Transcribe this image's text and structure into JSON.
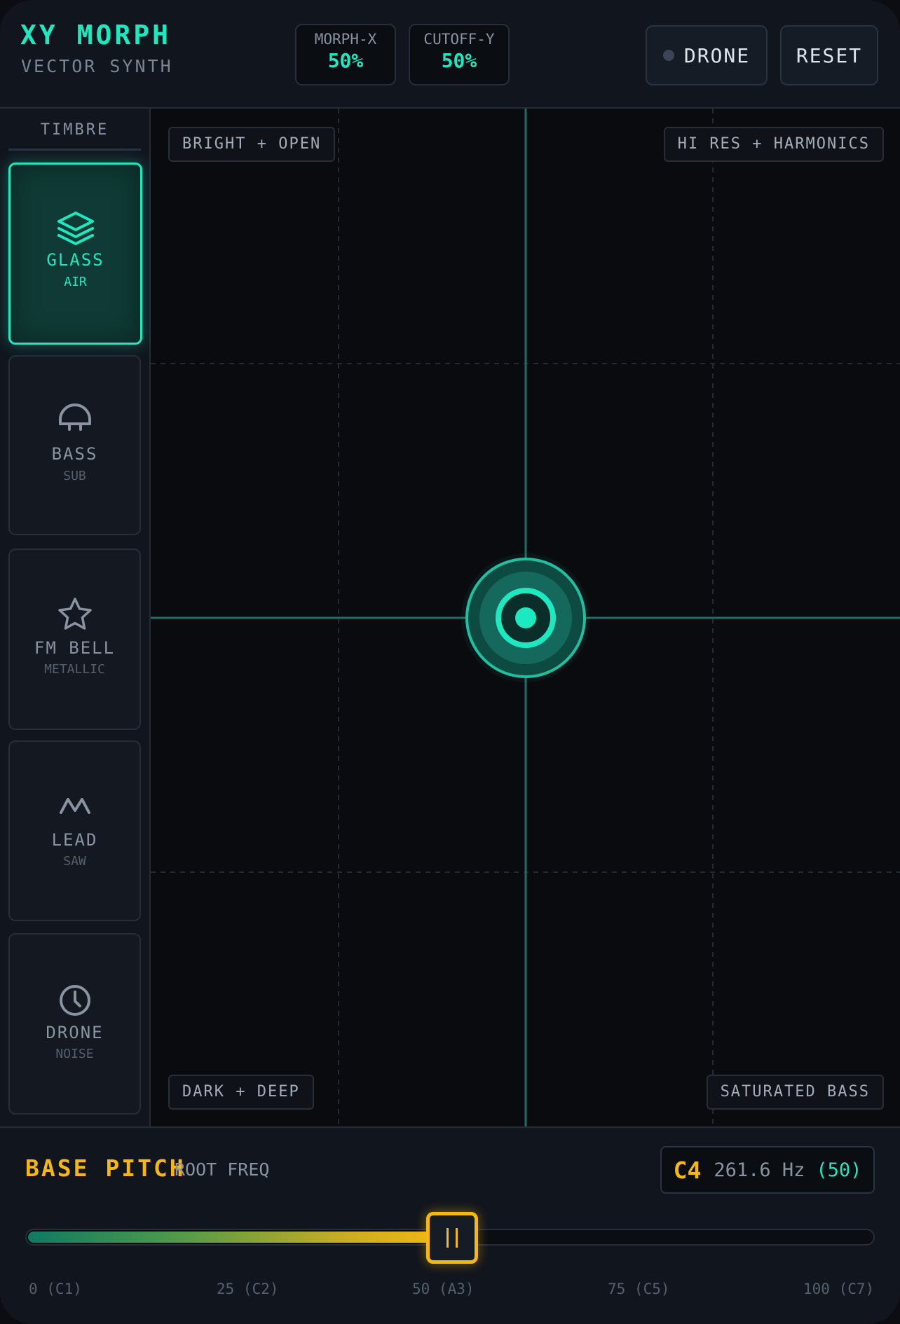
{
  "app": {
    "title": "XY MORPH",
    "subtitle": "VECTOR SYNTH"
  },
  "params": [
    {
      "label": "MORPH-X",
      "value": "50%"
    },
    {
      "label": "CUTOFF-Y",
      "value": "50%"
    }
  ],
  "header_buttons": {
    "drone": "DRONE",
    "reset": "RESET"
  },
  "sidebar": {
    "title": "TIMBRE",
    "items": [
      {
        "name": "GLASS",
        "sub": "AIR",
        "icon": "layers-icon",
        "active": true
      },
      {
        "name": "BASS",
        "sub": "SUB",
        "icon": "headphones-icon",
        "active": false
      },
      {
        "name": "FM BELL",
        "sub": "METALLIC",
        "icon": "star-icon",
        "active": false
      },
      {
        "name": "LEAD",
        "sub": "SAW",
        "icon": "saw-wave-icon",
        "active": false
      },
      {
        "name": "DRONE",
        "sub": "NOISE",
        "icon": "clock-icon",
        "active": false
      }
    ]
  },
  "pad": {
    "corners": {
      "top_left": "BRIGHT + OPEN",
      "top_right": "HI RES + HARMONICS",
      "bottom_left": "DARK + DEEP",
      "bottom_right": "SATURATED BASS"
    },
    "x_value": 0.5,
    "y_value": 0.5
  },
  "pitch": {
    "title": "BASE PITCH",
    "subtitle": "ROOT FREQ",
    "note": "C4",
    "hz": "261.6 Hz",
    "value_label": "(50)",
    "value": 50,
    "ticks": [
      "0 (C1)",
      "25 (C2)",
      "50 (A3)",
      "75 (C5)",
      "100 (C7)"
    ]
  },
  "colors": {
    "accent": "#1de9c1",
    "pitch": "#f5b812",
    "background": "#0b0d12",
    "panel": "#11151d"
  }
}
